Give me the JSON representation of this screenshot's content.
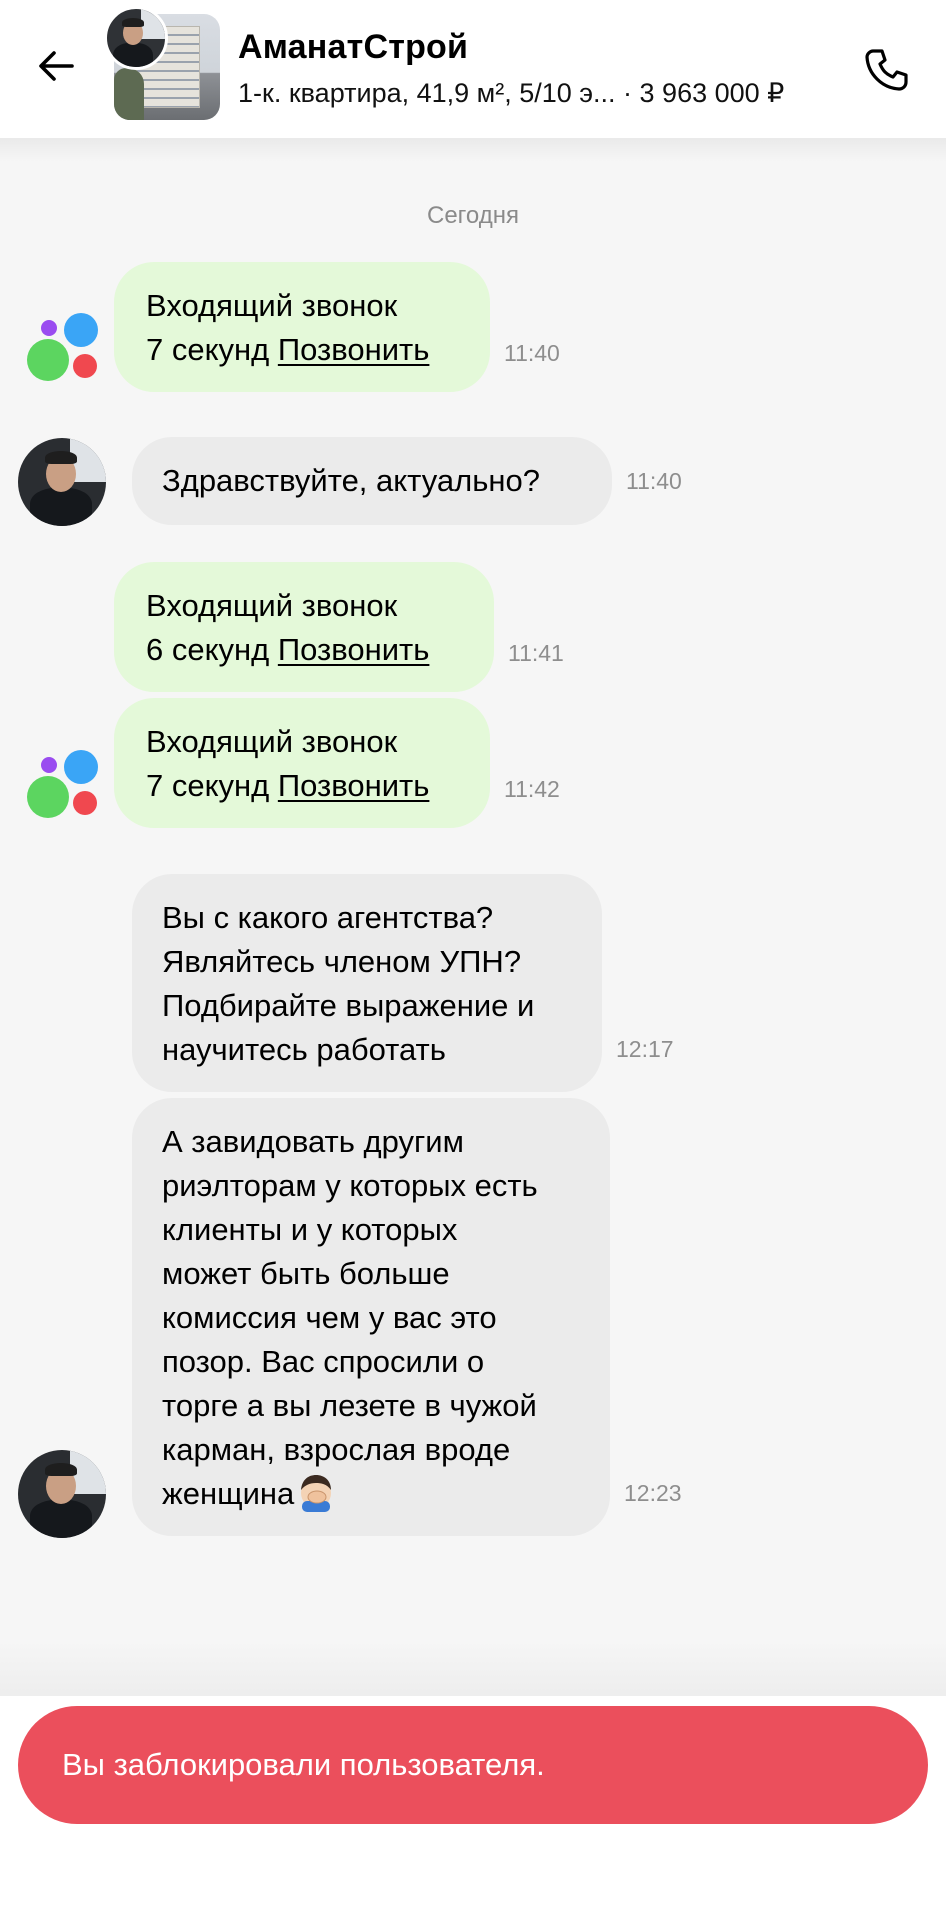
{
  "header": {
    "title": "АманатСтрой",
    "subtitle": "1-к. квартира, 41,9 м², 5/10 э... · 3 963 000 ₽"
  },
  "chat": {
    "date_label": "Сегодня",
    "messages": [
      {
        "line1": "Входящий звонок",
        "duration": "7 секунд",
        "callback": "Позвонить",
        "time": "11:40"
      },
      {
        "text": "Здравствуйте, актуально?",
        "time": "11:40"
      },
      {
        "line1": "Входящий звонок",
        "duration": "6 секунд",
        "callback": "Позвонить",
        "time": "11:41"
      },
      {
        "line1": "Входящий звонок",
        "duration": "7 секунд",
        "callback": "Позвонить",
        "time": "11:42"
      },
      {
        "lines": [
          "Вы с какого агентства?",
          "Являйтесь членом УПН?",
          "Подбирайте выражение и",
          "научитесь работать"
        ],
        "time": "12:17"
      },
      {
        "lines": [
          "А завидовать другим",
          "риэлторам у которых есть",
          "клиенты и у которых",
          "может быть больше",
          "комиссия чем у вас это",
          "позор. Вас спросили о",
          "торге а вы лезете в чужой",
          "карман, взрослая вроде",
          "женщина"
        ],
        "time": "12:23"
      }
    ]
  },
  "toast": {
    "text": "Вы заблокировали пользователя."
  },
  "colors": {
    "incoming_call_bubble": "#e4f9d9",
    "message_bubble": "#ebebeb",
    "toast_background": "#eb4f5c",
    "timestamp": "#8e8e8e"
  },
  "icons": {
    "back": "back-arrow-icon",
    "call": "phone-icon",
    "system": "avito-logo-icon",
    "emoji": "facepalm-emoji-icon"
  }
}
